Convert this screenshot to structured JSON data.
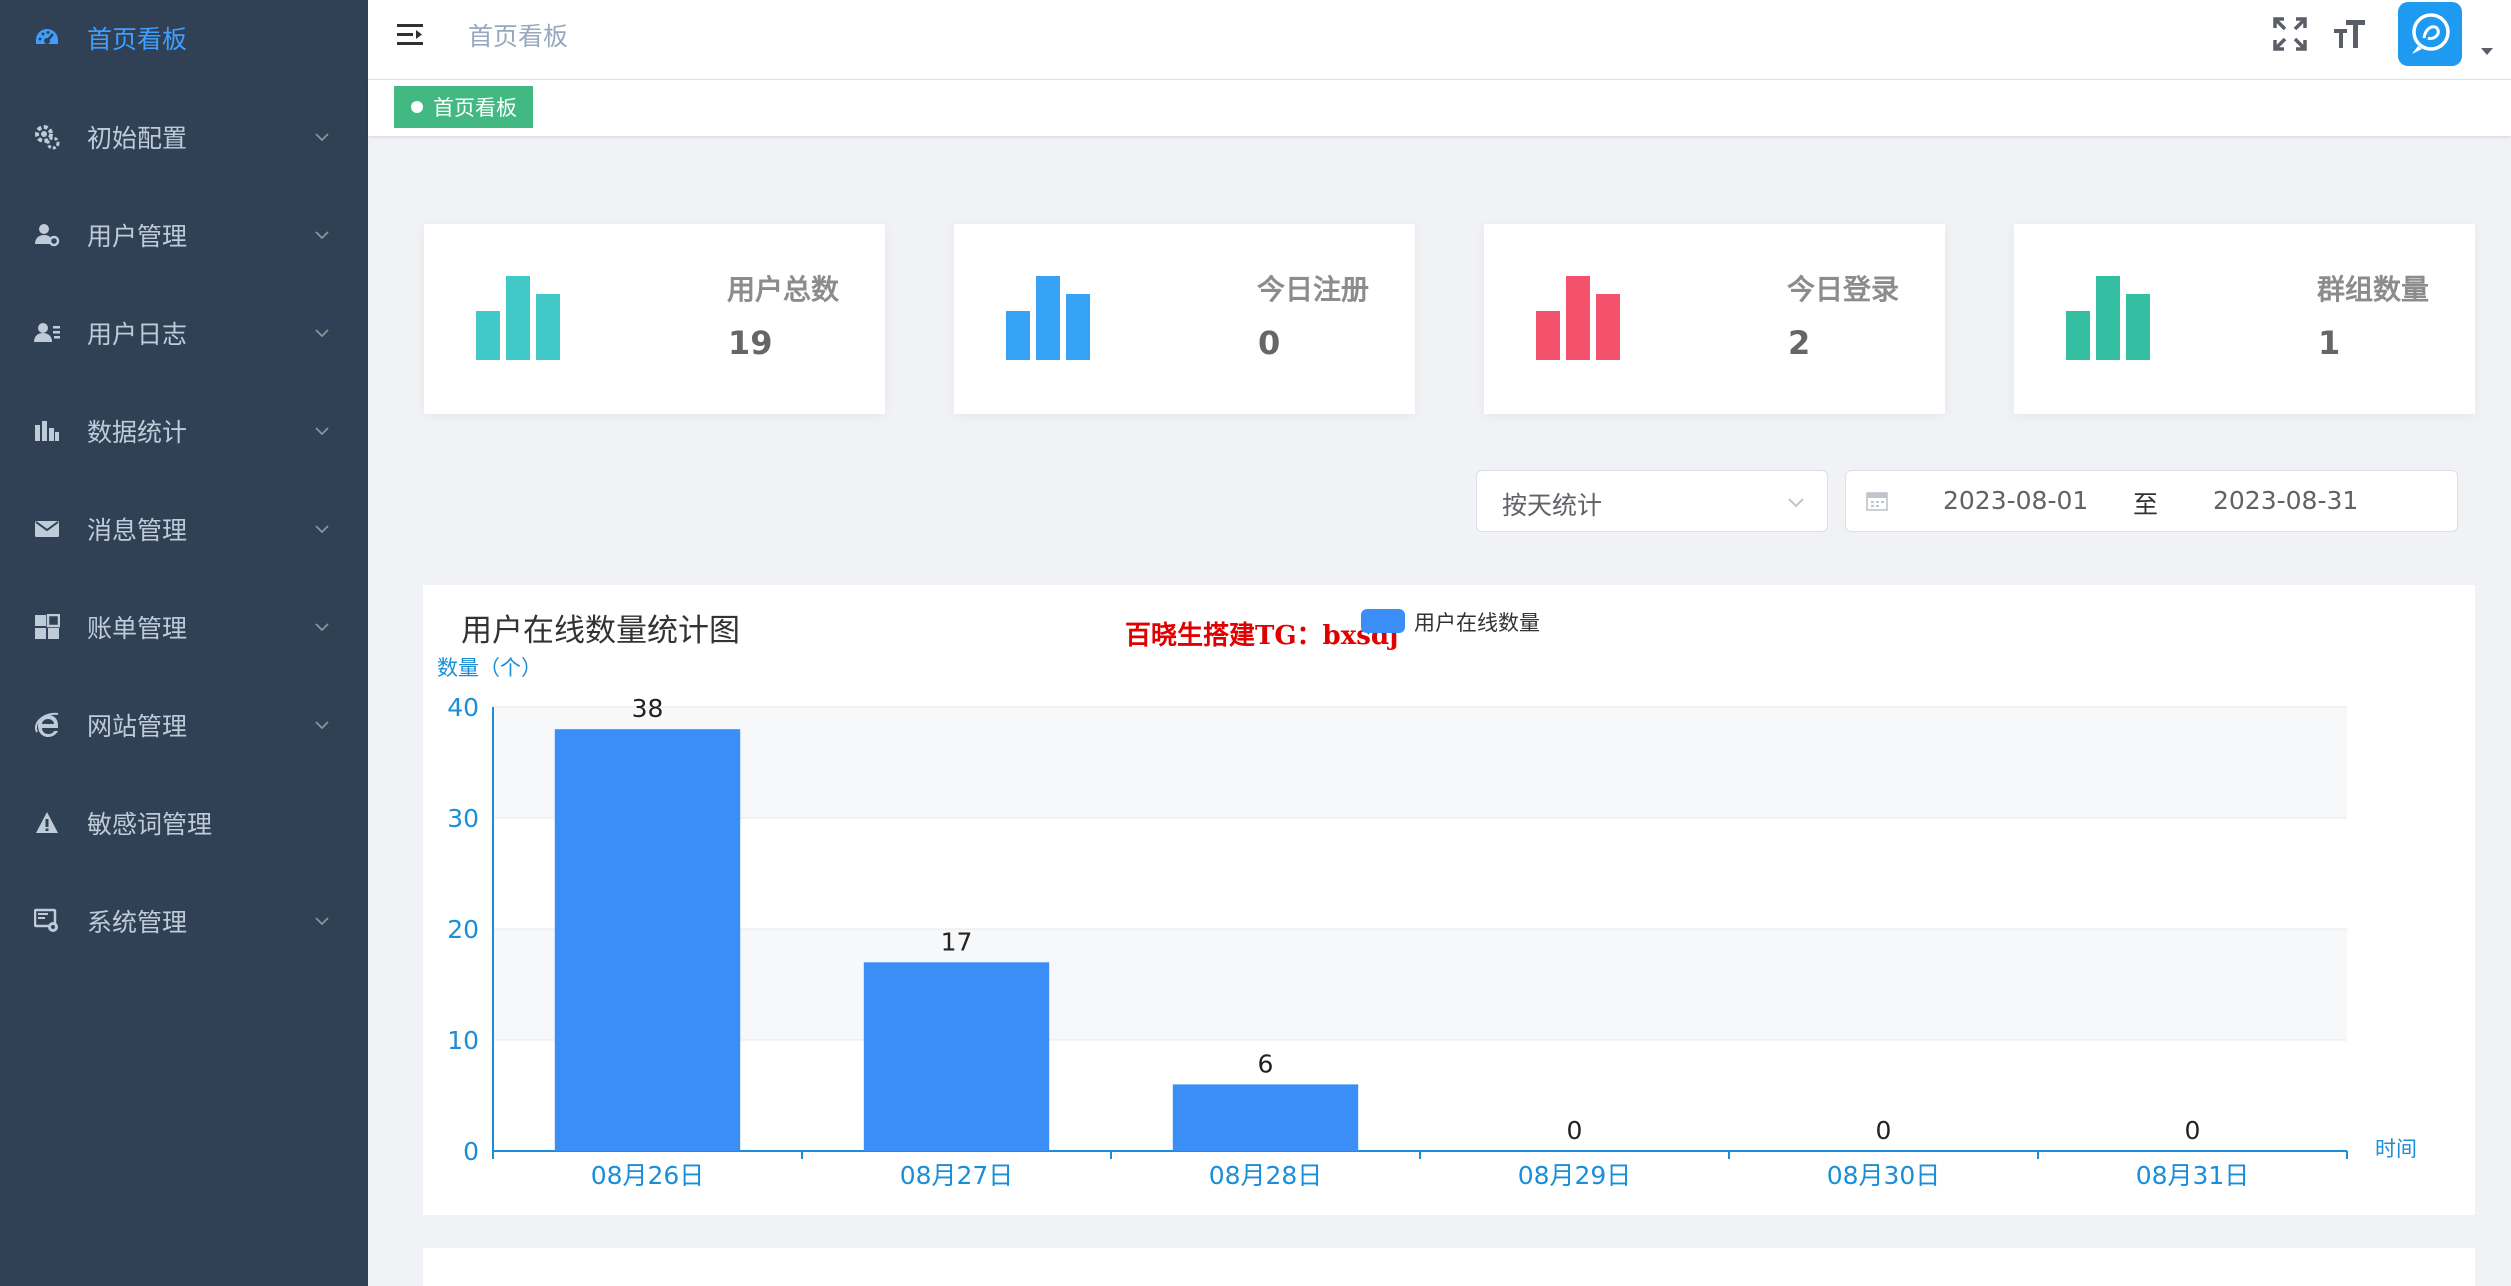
{
  "sidebar": {
    "items": [
      {
        "label": "首页看板",
        "icon": "dashboard-icon",
        "active": true,
        "has_children": false
      },
      {
        "label": "初始配置",
        "icon": "gear-icon",
        "active": false,
        "has_children": true
      },
      {
        "label": "用户管理",
        "icon": "user-gear-icon",
        "active": false,
        "has_children": true
      },
      {
        "label": "用户日志",
        "icon": "user-list-icon",
        "active": false,
        "has_children": true
      },
      {
        "label": "数据统计",
        "icon": "bar-chart-icon",
        "active": false,
        "has_children": true
      },
      {
        "label": "消息管理",
        "icon": "envelope-icon",
        "active": false,
        "has_children": true
      },
      {
        "label": "账单管理",
        "icon": "grid-icon",
        "active": false,
        "has_children": true
      },
      {
        "label": "网站管理",
        "icon": "browser-e-icon",
        "active": false,
        "has_children": true
      },
      {
        "label": "敏感词管理",
        "icon": "warning-icon",
        "active": false,
        "has_children": false
      },
      {
        "label": "系统管理",
        "icon": "monitor-gear-icon",
        "active": false,
        "has_children": true
      }
    ]
  },
  "header": {
    "breadcrumb": "首页看板",
    "icons": [
      "hamburger-icon",
      "fullscreen-icon",
      "font-size-icon",
      "avatar-logo-icon"
    ]
  },
  "tags": [
    {
      "label": "首页看板",
      "active": true
    }
  ],
  "stats": [
    {
      "label": "用户总数",
      "value": "19",
      "color": "#40c9c6"
    },
    {
      "label": "今日注册",
      "value": "0",
      "color": "#36a3f7"
    },
    {
      "label": "今日登录",
      "value": "2",
      "color": "#f4516c"
    },
    {
      "label": "群组数量",
      "value": "1",
      "color": "#34bfa3"
    }
  ],
  "filters": {
    "mode": "按天统计",
    "start_date": "2023-08-01",
    "separator": "至",
    "end_date": "2023-08-31"
  },
  "watermark": "百晓生搭建TG：bxsdj",
  "colors": {
    "sidebar_bg": "#304156",
    "active": "#409eff",
    "tag": "#42b983",
    "bar": "#3a8ef6",
    "axis": "#1a8fd8"
  },
  "chart_data": {
    "type": "bar",
    "title": "用户在线数量统计图",
    "legend": [
      "用户在线数量"
    ],
    "legend_position": "top-center",
    "xlabel": "时间",
    "ylabel": "数量（个）",
    "ylim": [
      0,
      40
    ],
    "yticks": [
      0,
      10,
      20,
      30,
      40
    ],
    "grid": true,
    "categories": [
      "08月26日",
      "08月27日",
      "08月28日",
      "08月29日",
      "08月30日",
      "08月31日"
    ],
    "series": [
      {
        "name": "用户在线数量",
        "values": [
          38,
          17,
          6,
          0,
          0,
          0
        ]
      }
    ]
  }
}
